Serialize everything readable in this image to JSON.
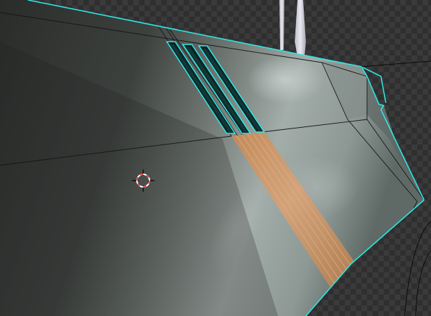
{
  "viewport": {
    "mode": "edit-mode",
    "background": "checker-transparent",
    "colors": {
      "checker_dark": "#2f2f2f",
      "checker_light": "#3d3d3d",
      "mesh_outline": "#2ee6e6",
      "selected_faces": "#e0995a",
      "wire": "#141414",
      "face_dark": "#2e302e",
      "face_light": "#a9b2af",
      "cursor_red": "#e34a4a"
    }
  },
  "objects": [
    {
      "name": "hull-panel",
      "selected": true
    },
    {
      "name": "vent-slot-1",
      "selected": true
    },
    {
      "name": "vent-slot-2",
      "selected": true
    },
    {
      "name": "vent-slot-3",
      "selected": true
    },
    {
      "name": "orange-stripe",
      "selected": true
    },
    {
      "name": "antenna-left",
      "selected": false
    },
    {
      "name": "antenna-right",
      "selected": false
    }
  ]
}
